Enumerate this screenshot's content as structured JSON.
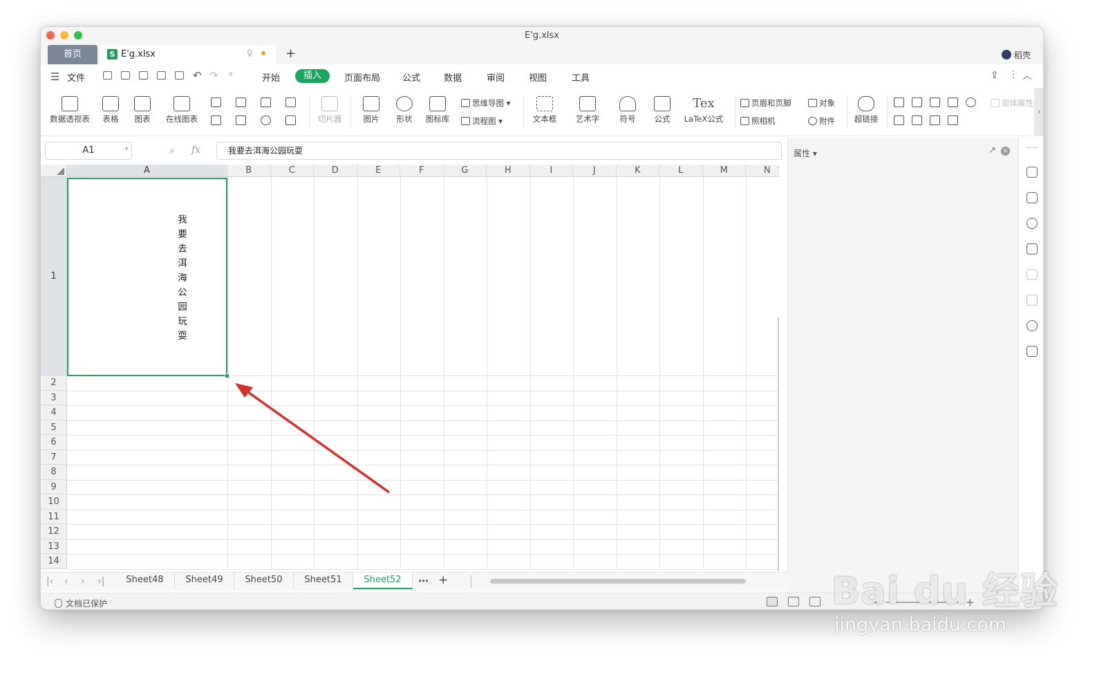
{
  "window": {
    "title": "E'g.xlsx"
  },
  "tabs": {
    "home": "首页",
    "doc": "E'g.xlsx",
    "user": "稻壳"
  },
  "menu": {
    "file": "文件",
    "items": [
      "开始",
      "插入",
      "页面布局",
      "公式",
      "数据",
      "审阅",
      "视图",
      "工具"
    ],
    "active": "插入"
  },
  "ribbon": {
    "pivot": "数据透视表",
    "table": "表格",
    "chart": "图表",
    "online_chart": "在线图表",
    "slicer": "切片器",
    "picture": "图片",
    "shape": "形状",
    "icon_lib": "图标库",
    "mindmap": "思维导图",
    "flowchart": "流程图",
    "textbox": "文本框",
    "wordart": "艺术字",
    "symbol": "符号",
    "formula": "公式",
    "latex_icon": "Tex",
    "latex": "LaTeX公式",
    "header_footer": "页眉和页脚",
    "camera": "照相机",
    "object": "对象",
    "attachment": "附件",
    "hyperlink": "超链接",
    "form_props": "窗体属性"
  },
  "formula_bar": {
    "name_box": "A1",
    "fx": "fx",
    "content": "我要去洱海公园玩耍"
  },
  "grid": {
    "columns": [
      "A",
      "B",
      "C",
      "D",
      "E",
      "F",
      "G",
      "H",
      "I",
      "J",
      "K",
      "L",
      "M",
      "N"
    ],
    "rows": [
      "1",
      "2",
      "3",
      "4",
      "5",
      "6",
      "7",
      "8",
      "9",
      "10",
      "11",
      "12",
      "13",
      "14"
    ],
    "cell_A1": "我要去洱海公园玩耍"
  },
  "side_panel": {
    "title": "属性 ▾"
  },
  "sheets": {
    "tabs": [
      "Sheet48",
      "Sheet49",
      "Sheet50",
      "Sheet51",
      "Sheet52"
    ],
    "active": "Sheet52",
    "more": "⋯",
    "add": "+"
  },
  "status": {
    "protect": "文档已保护"
  },
  "watermark": {
    "main": "Bai du 经验",
    "sub": "jingyan.baidu.com"
  },
  "colors": {
    "accent": "#1aa760",
    "arrow": "#d9302c"
  }
}
